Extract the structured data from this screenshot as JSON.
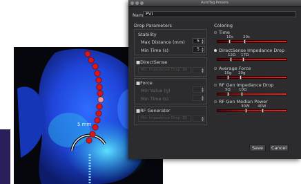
{
  "window": {
    "title": "AutoTag Presets"
  },
  "name_field": {
    "label": "Name:",
    "value": "PVI"
  },
  "drop_parameters": {
    "title": "Drop Parameters",
    "stability": {
      "title": "Stability",
      "max_distance": {
        "label": "Max Distance (mm)",
        "value": "5"
      },
      "min_time": {
        "label": "Min Time (s)",
        "value": "5"
      }
    },
    "direct_sense": {
      "title": "DirectSense",
      "field_placeholder": "Min Impedance Drop (Ω)"
    },
    "force": {
      "title": "Force",
      "min_value": {
        "label": "Min Value (g)"
      },
      "min_time": {
        "label": "Min Time (s)"
      }
    },
    "rf_generator": {
      "title": "RF Generator",
      "field_placeholder": "Min Impedance Drop (Ω)"
    }
  },
  "coloring": {
    "title": "Coloring",
    "items": [
      {
        "label": "Time",
        "selected": false,
        "min": "10s",
        "max": "20s"
      },
      {
        "label": "DirectSense Impedance Drop",
        "selected": true,
        "min": "12Ω",
        "max": "17Ω"
      },
      {
        "label": "Average Force",
        "selected": false,
        "min": "10g",
        "max": "20g"
      },
      {
        "label": "RF Gen Impedance Drop",
        "selected": false,
        "min": "5Ω",
        "max": "10Ω"
      },
      {
        "label": "RF Gen Median Power",
        "selected": false,
        "min": "30W",
        "max": "40W"
      }
    ]
  },
  "buttons": {
    "save": "Save",
    "cancel": "Cancel"
  },
  "map": {
    "distance_label": "5 mm"
  },
  "colors": {
    "dialog_bg": "#2c2c2e",
    "slider_red": "#c81e1e",
    "tag_red": "#d81818",
    "map_blue": "#2a5cff"
  }
}
